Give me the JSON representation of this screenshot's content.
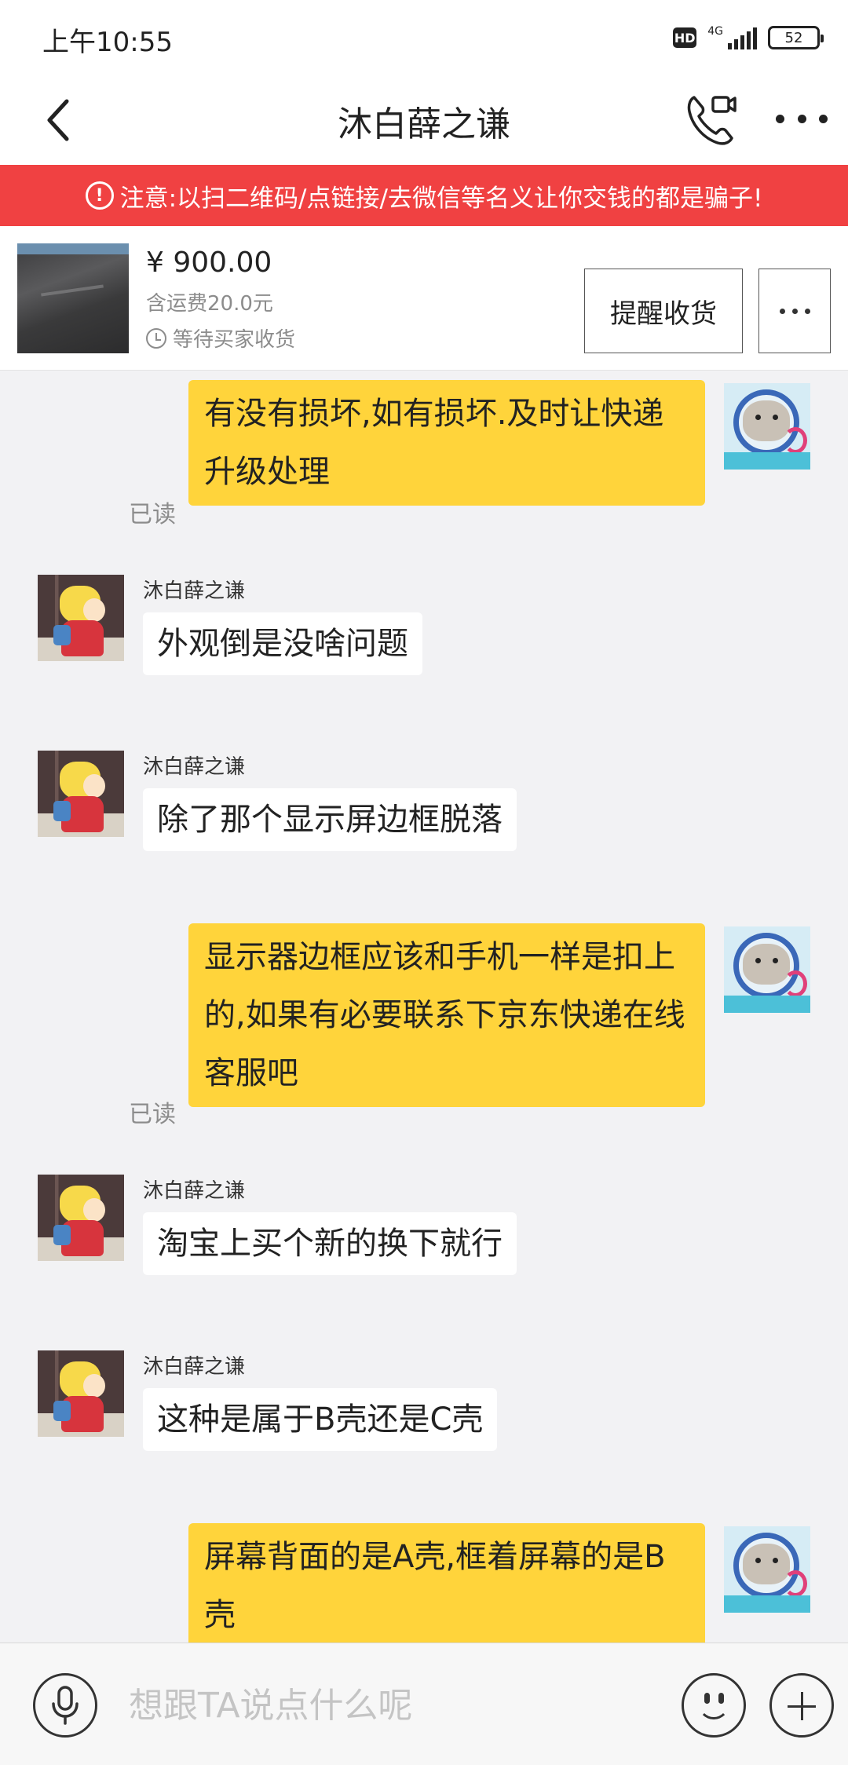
{
  "status_bar": {
    "time": "上午10:55",
    "hd": "HD",
    "network": "4G",
    "battery": "52"
  },
  "header": {
    "title": "沐白薛之谦",
    "icons": {
      "back": "back-chevron-icon",
      "call": "phone-video-icon",
      "more": "more-dots-icon"
    }
  },
  "warning": {
    "icon": "!",
    "text": "注意:以扫二维码/点链接/去微信等名义让你交钱的都是骗子!"
  },
  "order": {
    "price": "¥ 900.00",
    "shipping": "含运费20.0元",
    "status": "等待买家收货",
    "remind_label": "提醒收货"
  },
  "messages": [
    {
      "side": "me",
      "text": "有没有损坏,如有损坏.及时让快递升级处理",
      "read": "已读"
    },
    {
      "side": "other",
      "sender": "沐白薛之谦",
      "text": "外观倒是没啥问题"
    },
    {
      "side": "other",
      "sender": "沐白薛之谦",
      "text": "除了那个显示屏边框脱落"
    },
    {
      "side": "me",
      "text": "显示器边框应该和手机一样是扣上的,如果有必要联系下京东快递在线客服吧",
      "read": "已读"
    },
    {
      "side": "other",
      "sender": "沐白薛之谦",
      "text": "淘宝上买个新的换下就行"
    },
    {
      "side": "other",
      "sender": "沐白薛之谦",
      "text": "这种是属于B壳还是C壳"
    },
    {
      "side": "me",
      "text": "屏幕背面的是A壳,框着屏幕的是B壳"
    }
  ],
  "input": {
    "placeholder": "想跟TA说点什么呢"
  },
  "colors": {
    "warning_bg": "#f04142",
    "my_bubble": "#ffd43b",
    "their_bubble": "#ffffff",
    "chat_bg": "#f2f2f4"
  }
}
